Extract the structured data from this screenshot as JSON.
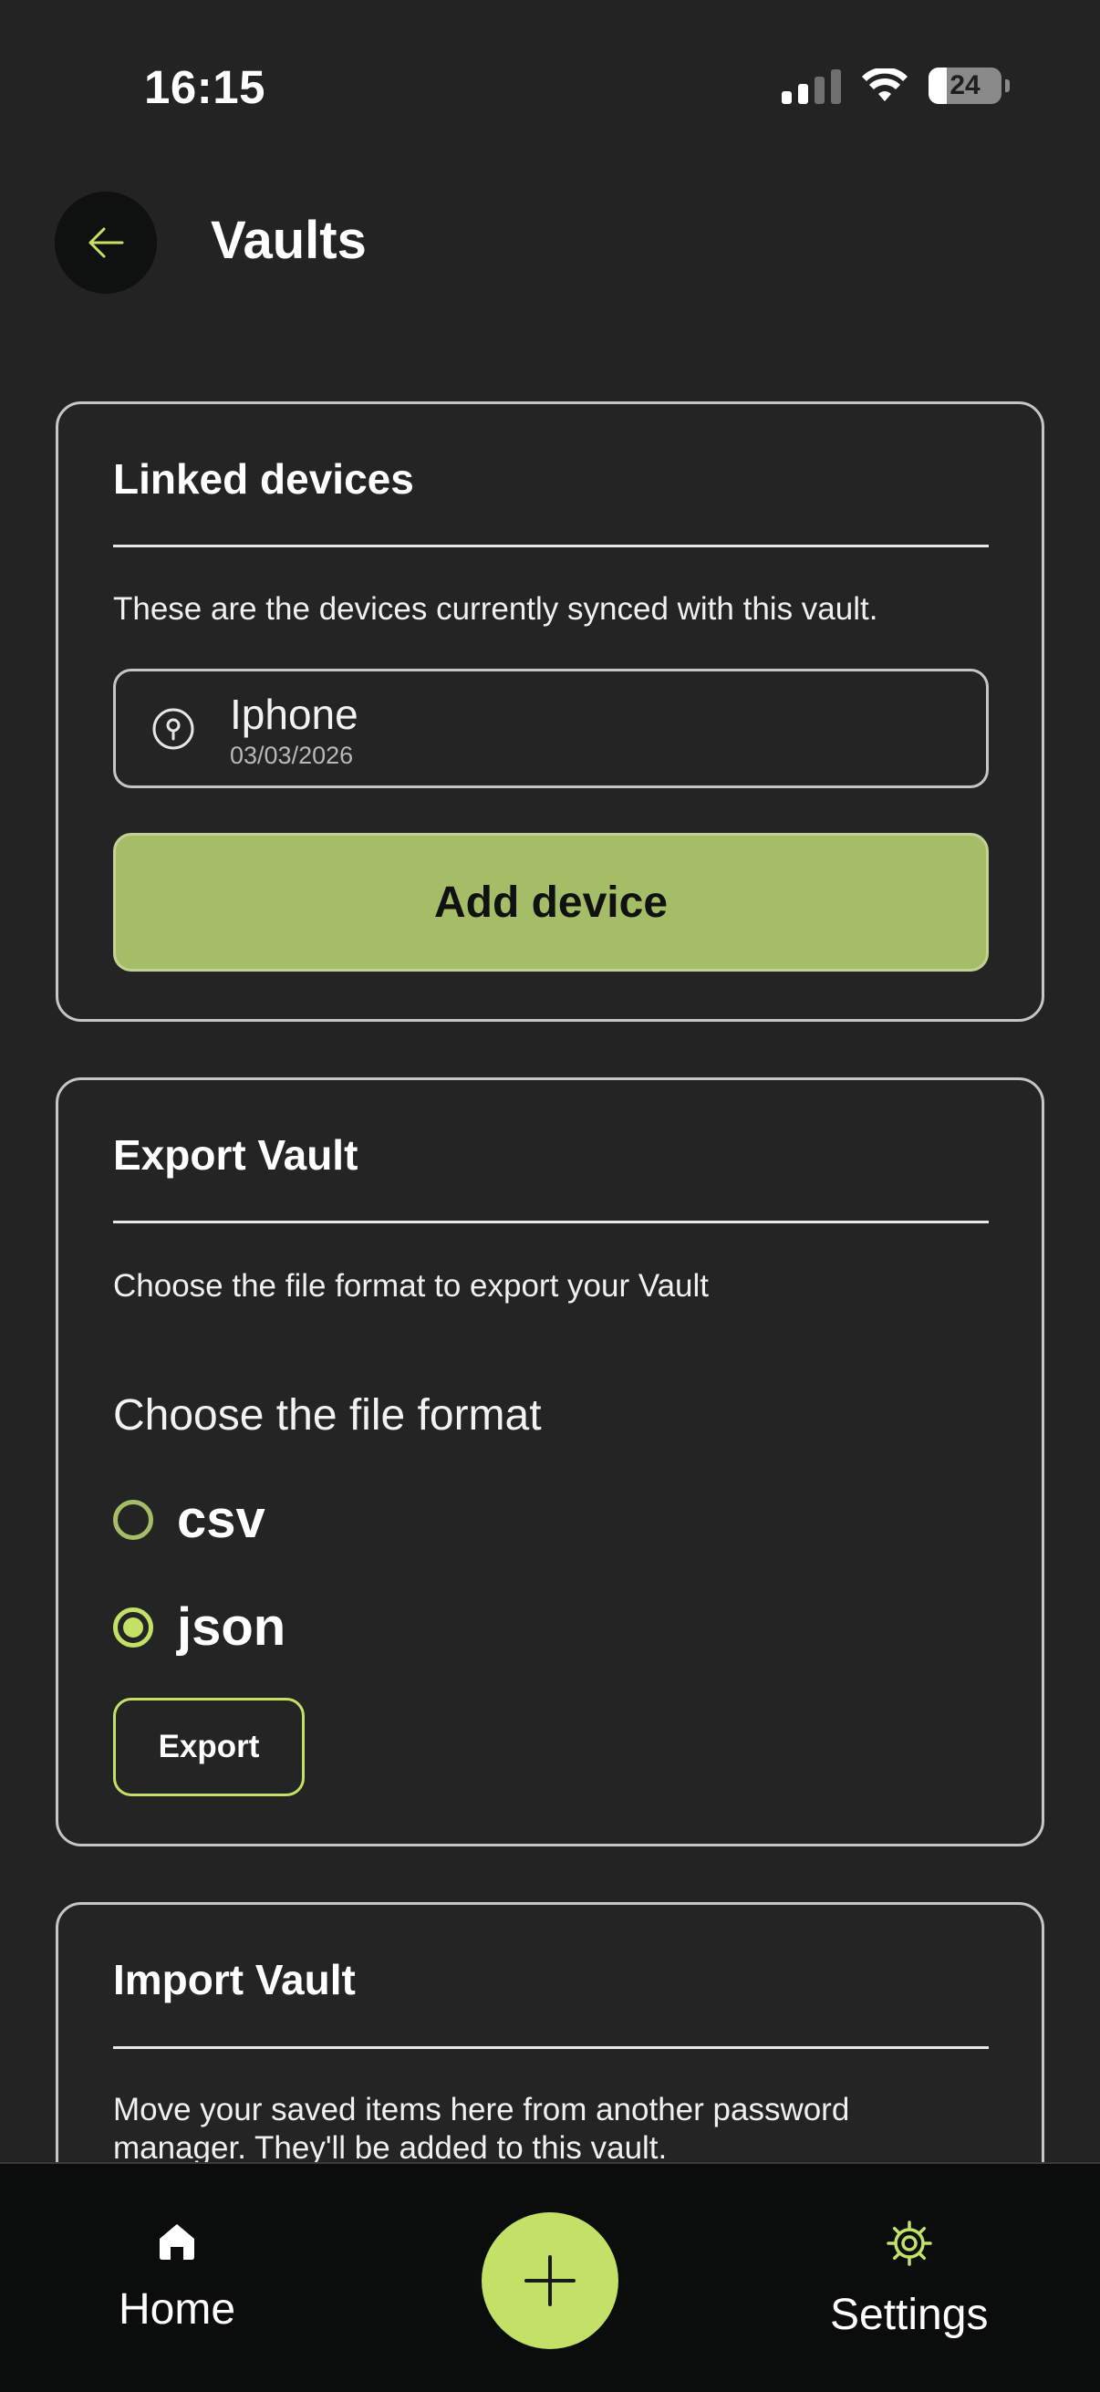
{
  "status_bar": {
    "time": "16:15",
    "battery_level": "24"
  },
  "header": {
    "title": "Vaults",
    "back_icon": "arrow-left-icon"
  },
  "linked_devices": {
    "title": "Linked devices",
    "description": "These are the devices currently synced with this vault.",
    "devices": [
      {
        "name": "Iphone",
        "date": "03/03/2026",
        "icon": "location-pin-icon"
      }
    ],
    "add_button_label": "Add device"
  },
  "export_vault": {
    "title": "Export Vault",
    "description": "Choose the file format to export your Vault",
    "format_label": "Choose the file format",
    "options": [
      {
        "label": "csv",
        "selected": false
      },
      {
        "label": "json",
        "selected": true
      }
    ],
    "export_button_label": "Export"
  },
  "import_vault": {
    "title": "Import Vault",
    "description": "Move your saved items here from another password manager. They'll be added to this vault."
  },
  "bottom_nav": {
    "home_label": "Home",
    "settings_label": "Settings",
    "fab_icon": "plus-icon"
  },
  "colors": {
    "accent": "#c3e067",
    "accent_muted": "#a6bd68",
    "background": "#232324",
    "nav_background": "#0b0d0c"
  }
}
